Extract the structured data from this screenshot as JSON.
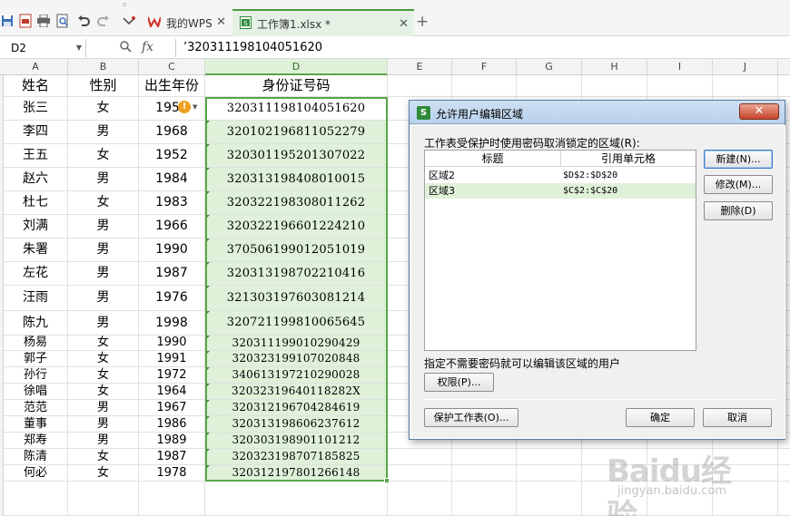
{
  "tabs": {
    "wps_label": "我的WPS",
    "wps_close": "✕",
    "workbook_label": "工作簿1.xlsx *",
    "workbook_close": "✕",
    "add": "+"
  },
  "formula": {
    "name_box": "D2",
    "fx": "fx",
    "value": "’320311198104051620"
  },
  "columns": [
    "A",
    "B",
    "C",
    "D",
    "E",
    "F",
    "G",
    "H",
    "I",
    "J"
  ],
  "table": {
    "headers": [
      "姓名",
      "性别",
      "出生年份",
      "身份证号码"
    ],
    "rows": [
      [
        "张三",
        "女",
        "1951",
        "320311198104051620"
      ],
      [
        "李四",
        "男",
        "1968",
        "320102196811052279"
      ],
      [
        "王五",
        "女",
        "1952",
        "320301195201307022"
      ],
      [
        "赵六",
        "男",
        "1984",
        "320313198408010015"
      ],
      [
        "杜七",
        "女",
        "1983",
        "320322198308011262"
      ],
      [
        "刘满",
        "男",
        "1966",
        "320322196601224210"
      ],
      [
        "朱署",
        "男",
        "1990",
        "370506199012051019"
      ],
      [
        "左花",
        "男",
        "1987",
        "320313198702210416"
      ],
      [
        "汪雨",
        "男",
        "1976",
        "321303197603081214"
      ],
      [
        "陈九",
        "男",
        "1998",
        "320721199810065645"
      ],
      [
        "杨易",
        "女",
        "1990",
        "320311199010290429"
      ],
      [
        "郭子",
        "女",
        "1991",
        "320323199107020848"
      ],
      [
        "孙行",
        "女",
        "1972",
        "340613197210290028"
      ],
      [
        "徐唱",
        "女",
        "1964",
        "32032319640118282X"
      ],
      [
        "范范",
        "男",
        "1967",
        "320312196704284619"
      ],
      [
        "董事",
        "男",
        "1986",
        "320313198606237612"
      ],
      [
        "郑寿",
        "男",
        "1989",
        "320303198901101212"
      ],
      [
        "陈清",
        "女",
        "1987",
        "320323198707185825"
      ],
      [
        "何必",
        "女",
        "1978",
        "320312197801266148"
      ]
    ]
  },
  "dialog": {
    "title": "允许用户编辑区域",
    "close": "✕",
    "ranges_label": "工作表受保护时使用密码取消锁定的区域(R):",
    "list_headers": [
      "标题",
      "引用单元格"
    ],
    "list_rows": [
      {
        "name": "区域2",
        "ref": "$D$2:$D$20"
      },
      {
        "name": "区域3",
        "ref": "$C$2:$C$20"
      }
    ],
    "selected_index": 1,
    "btn_new": "新建(N)...",
    "btn_modify": "修改(M)...",
    "btn_delete": "删除(D)",
    "users_label": "指定不需要密码就可以编辑该区域的用户",
    "btn_permission": "权限(P)...",
    "btn_protect": "保护工作表(O)...",
    "btn_ok": "确定",
    "btn_cancel": "取消"
  },
  "watermark": {
    "brand": "Baidu经验",
    "url": "jingyan.baidu.com"
  },
  "colors": {
    "accent_green": "#57a548",
    "selected_fill": "#dff1d8",
    "dialog_title": "#cfe0f3",
    "close_red": "#c7452a"
  }
}
